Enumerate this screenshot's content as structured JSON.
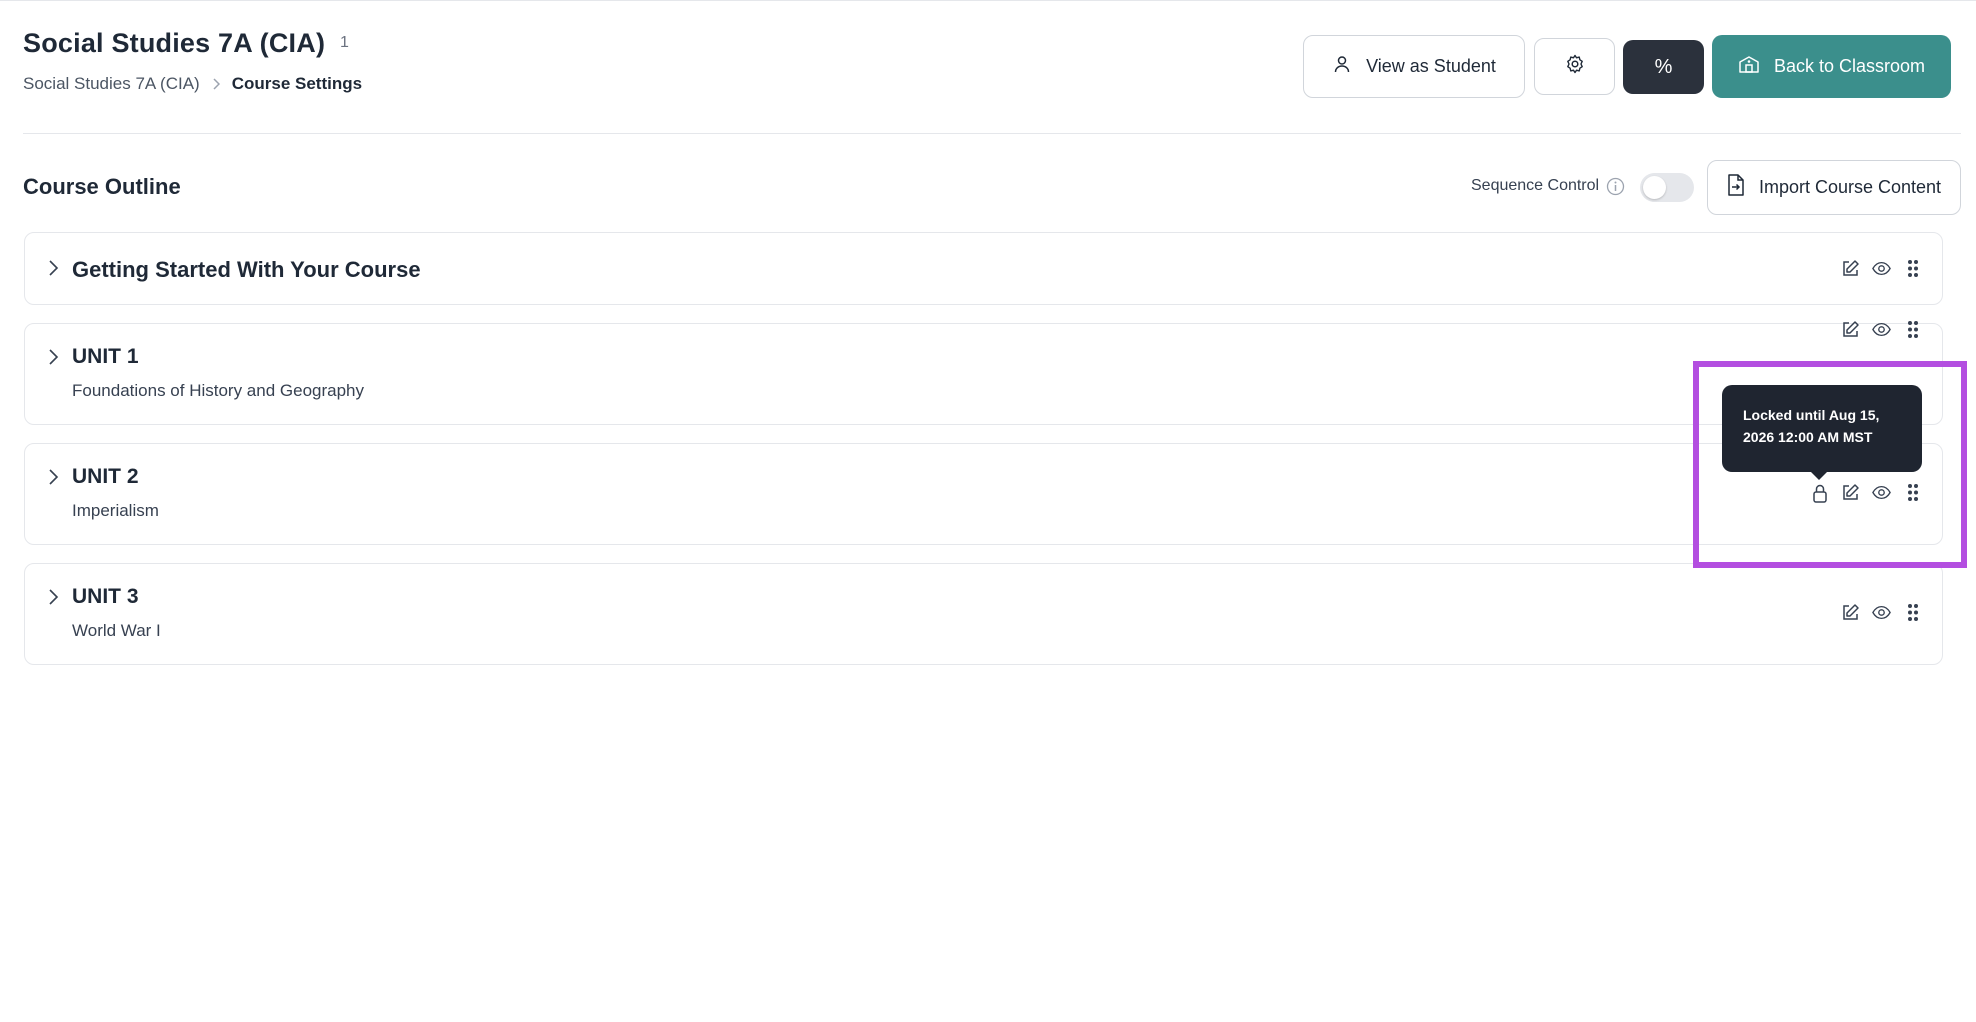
{
  "header": {
    "title": "Social Studies 7A (CIA)",
    "title_count": "1",
    "breadcrumb": {
      "parent": "Social Studies 7A (CIA)",
      "current": "Course Settings"
    }
  },
  "toolbar": {
    "view_as_student": "View as Student",
    "gear_icon": "gear-icon",
    "percent_label": "%",
    "back_to_classroom": "Back to Classroom"
  },
  "outline": {
    "title": "Course Outline",
    "sequence_control_label": "Sequence Control",
    "sequence_control_on": false,
    "import_label": "Import Course Content",
    "rows": [
      {
        "title": "Getting Started With Your Course",
        "subtitle": "",
        "locked": false
      },
      {
        "title": "UNIT 1",
        "subtitle": "Foundations of History and Geography",
        "locked": false
      },
      {
        "title": "UNIT 2",
        "subtitle": "Imperialism",
        "locked": true
      },
      {
        "title": "UNIT 3",
        "subtitle": "World War I",
        "locked": false
      }
    ]
  },
  "tooltip": {
    "text": "Locked until Aug 15, 2026 12:00 AM MST"
  },
  "colors": {
    "accent": "#3b8f8c",
    "dark_button": "#2b313c",
    "tooltip_bg": "#1f2530",
    "highlight": "#b34ee0"
  }
}
